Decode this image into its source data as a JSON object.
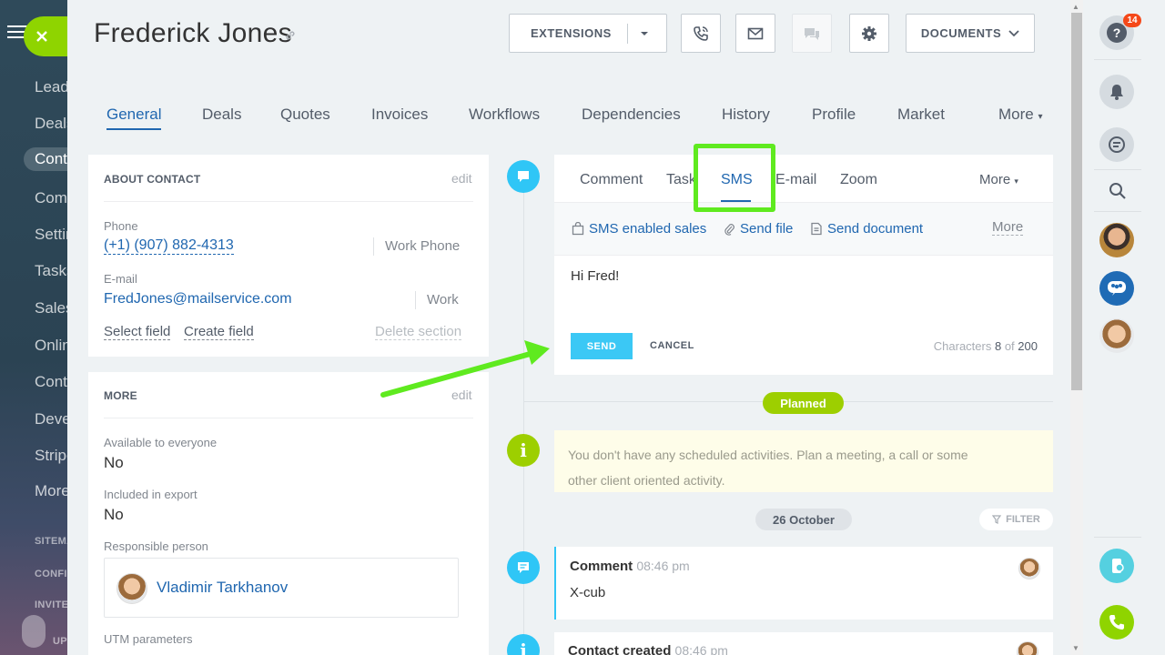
{
  "sidebar": {
    "items": [
      "Leads",
      "Deals",
      "Contacts",
      "Companies",
      "Settings",
      "Tasks",
      "Sales",
      "Online",
      "Contact",
      "Developer",
      "Stripe",
      "More"
    ],
    "small_items": [
      "SITEMAP",
      "CONFIGURE",
      "INVITE",
      "UP"
    ]
  },
  "contact": {
    "name": "Frederick  Jones"
  },
  "toolbar": {
    "extensions": "EXTENSIONS",
    "documents": "DOCUMENTS"
  },
  "tabs": [
    "General",
    "Deals",
    "Quotes",
    "Invoices",
    "Workflows",
    "Dependencies",
    "History",
    "Profile",
    "Market",
    "More"
  ],
  "about": {
    "title": "ABOUT CONTACT",
    "edit": "edit",
    "phone_label": "Phone",
    "phone_value": "(+1) (907) 882-4313",
    "phone_type": "Work Phone",
    "email_label": "E-mail",
    "email_value": "FredJones@mailservice.com",
    "email_type": "Work",
    "select_field": "Select field",
    "create_field": "Create field",
    "delete_section": "Delete section"
  },
  "more": {
    "title": "MORE",
    "edit": "edit",
    "available_label": "Available to everyone",
    "available_value": "No",
    "export_label": "Included in export",
    "export_value": "No",
    "responsible_label": "Responsible person",
    "responsible_name": "Vladimir Tarkhanov",
    "utm_label": "UTM parameters"
  },
  "composer": {
    "tabs": [
      "Comment",
      "Task",
      "SMS",
      "E-mail",
      "Zoom"
    ],
    "more": "More",
    "sub_links": [
      "SMS enabled sales",
      "Send file",
      "Send document"
    ],
    "sub_more": "More",
    "message": "Hi Fred!",
    "send": "SEND",
    "cancel": "CANCEL",
    "chars_prefix": "Characters",
    "chars_count": "8",
    "chars_of": "of",
    "chars_max": "200"
  },
  "timeline": {
    "planned": "Planned",
    "planned_text_1": "You don't have any scheduled activities. Plan a meeting, a call or some",
    "planned_text_2": "other client oriented activity.",
    "date": "26 October",
    "filter": "FILTER",
    "comment_title": "Comment",
    "comment_time": "08:46 pm",
    "comment_body": "X-cub",
    "created_title": "Contact created",
    "created_time": "08:46 pm"
  },
  "right_bar": {
    "help_badge": "14"
  },
  "colors": {
    "accent": "#2067b0",
    "green": "#8fd400",
    "highlight": "#5fea1f",
    "timeline_blue": "#2fc6f6",
    "send_btn": "#3bc8f5"
  }
}
